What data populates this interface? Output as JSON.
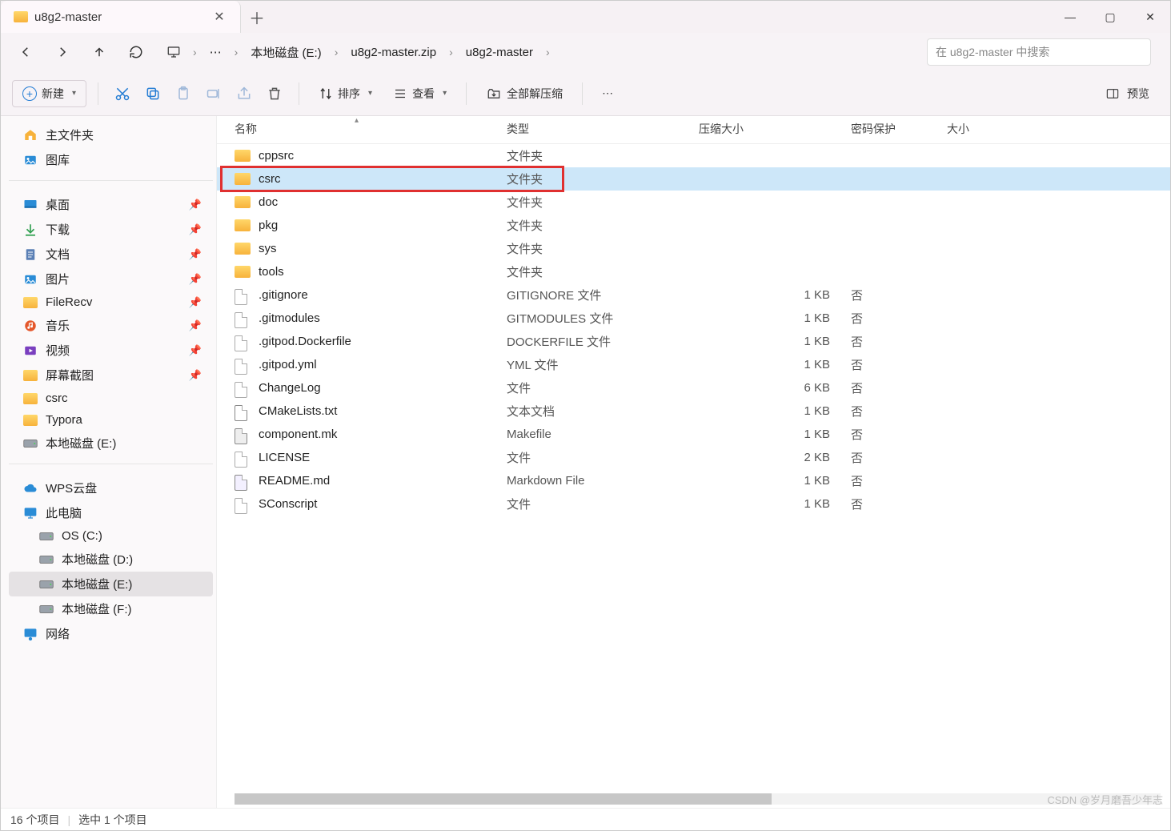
{
  "tab": {
    "title": "u8g2-master"
  },
  "window_controls": {
    "min": "—",
    "max": "▢",
    "close": "✕"
  },
  "breadcrumb": {
    "monitor_icon": "monitor",
    "dots": "⋯",
    "segs": [
      "本地磁盘 (E:)",
      "u8g2-master.zip",
      "u8g2-master"
    ]
  },
  "search": {
    "placeholder": "在 u8g2-master 中搜索"
  },
  "toolbar": {
    "new": "新建",
    "sort": "排序",
    "view": "查看",
    "extract": "全部解压缩",
    "preview": "预览",
    "dots": "⋯"
  },
  "sidebar": {
    "g1": [
      {
        "icon": "home",
        "label": "主文件夹"
      },
      {
        "icon": "gallery",
        "label": "图库"
      }
    ],
    "g2": [
      {
        "icon": "desktop",
        "label": "桌面",
        "pin": true
      },
      {
        "icon": "download",
        "label": "下载",
        "pin": true
      },
      {
        "icon": "doc",
        "label": "文档",
        "pin": true
      },
      {
        "icon": "image",
        "label": "图片",
        "pin": true
      },
      {
        "icon": "folder",
        "label": "FileRecv",
        "pin": true
      },
      {
        "icon": "music",
        "label": "音乐",
        "pin": true
      },
      {
        "icon": "video",
        "label": "视频",
        "pin": true
      },
      {
        "icon": "folder",
        "label": "屏幕截图",
        "pin": true
      },
      {
        "icon": "folder",
        "label": "csrc"
      },
      {
        "icon": "folder",
        "label": "Typora"
      },
      {
        "icon": "disk",
        "label": "本地磁盘 (E:)"
      }
    ],
    "g3": [
      {
        "icon": "cloud",
        "label": "WPS云盘"
      },
      {
        "icon": "pc",
        "label": "此电脑"
      },
      {
        "icon": "disk",
        "label": "OS (C:)",
        "indent": true
      },
      {
        "icon": "disk",
        "label": "本地磁盘 (D:)",
        "indent": true
      },
      {
        "icon": "disk",
        "label": "本地磁盘 (E:)",
        "indent": true,
        "selected": true
      },
      {
        "icon": "disk",
        "label": "本地磁盘 (F:)",
        "indent": true
      },
      {
        "icon": "network",
        "label": "网络"
      }
    ]
  },
  "columns": {
    "name": "名称",
    "type": "类型",
    "csize": "压缩大小",
    "pwd": "密码保护",
    "size": "大小"
  },
  "rows": [
    {
      "kind": "folder",
      "name": "cppsrc",
      "type": "文件夹",
      "csize": "",
      "pwd": ""
    },
    {
      "kind": "folder",
      "name": "csrc",
      "type": "文件夹",
      "csize": "",
      "pwd": "",
      "selected": true,
      "highlight": true
    },
    {
      "kind": "folder",
      "name": "doc",
      "type": "文件夹",
      "csize": "",
      "pwd": ""
    },
    {
      "kind": "folder",
      "name": "pkg",
      "type": "文件夹",
      "csize": "",
      "pwd": ""
    },
    {
      "kind": "folder",
      "name": "sys",
      "type": "文件夹",
      "csize": "",
      "pwd": ""
    },
    {
      "kind": "folder",
      "name": "tools",
      "type": "文件夹",
      "csize": "",
      "pwd": ""
    },
    {
      "kind": "file",
      "name": ".gitignore",
      "type": "GITIGNORE 文件",
      "csize": "1 KB",
      "pwd": "否"
    },
    {
      "kind": "file",
      "name": ".gitmodules",
      "type": "GITMODULES 文件",
      "csize": "1 KB",
      "pwd": "否"
    },
    {
      "kind": "file",
      "name": ".gitpod.Dockerfile",
      "type": "DOCKERFILE 文件",
      "csize": "1 KB",
      "pwd": "否"
    },
    {
      "kind": "file",
      "name": ".gitpod.yml",
      "type": "YML 文件",
      "csize": "1 KB",
      "pwd": "否"
    },
    {
      "kind": "file",
      "name": "ChangeLog",
      "type": "文件",
      "csize": "6 KB",
      "pwd": "否"
    },
    {
      "kind": "text",
      "name": "CMakeLists.txt",
      "type": "文本文档",
      "csize": "1 KB",
      "pwd": "否"
    },
    {
      "kind": "mk",
      "name": "component.mk",
      "type": "Makefile",
      "csize": "1 KB",
      "pwd": "否"
    },
    {
      "kind": "file",
      "name": "LICENSE",
      "type": "文件",
      "csize": "2 KB",
      "pwd": "否"
    },
    {
      "kind": "md",
      "name": "README.md",
      "type": "Markdown File",
      "csize": "1 KB",
      "pwd": "否"
    },
    {
      "kind": "file",
      "name": "SConscript",
      "type": "文件",
      "csize": "1 KB",
      "pwd": "否"
    }
  ],
  "statusbar": {
    "count": "16 个项目",
    "selection": "选中 1 个项目"
  },
  "watermark": "CSDN @岁月磨吾少年志"
}
